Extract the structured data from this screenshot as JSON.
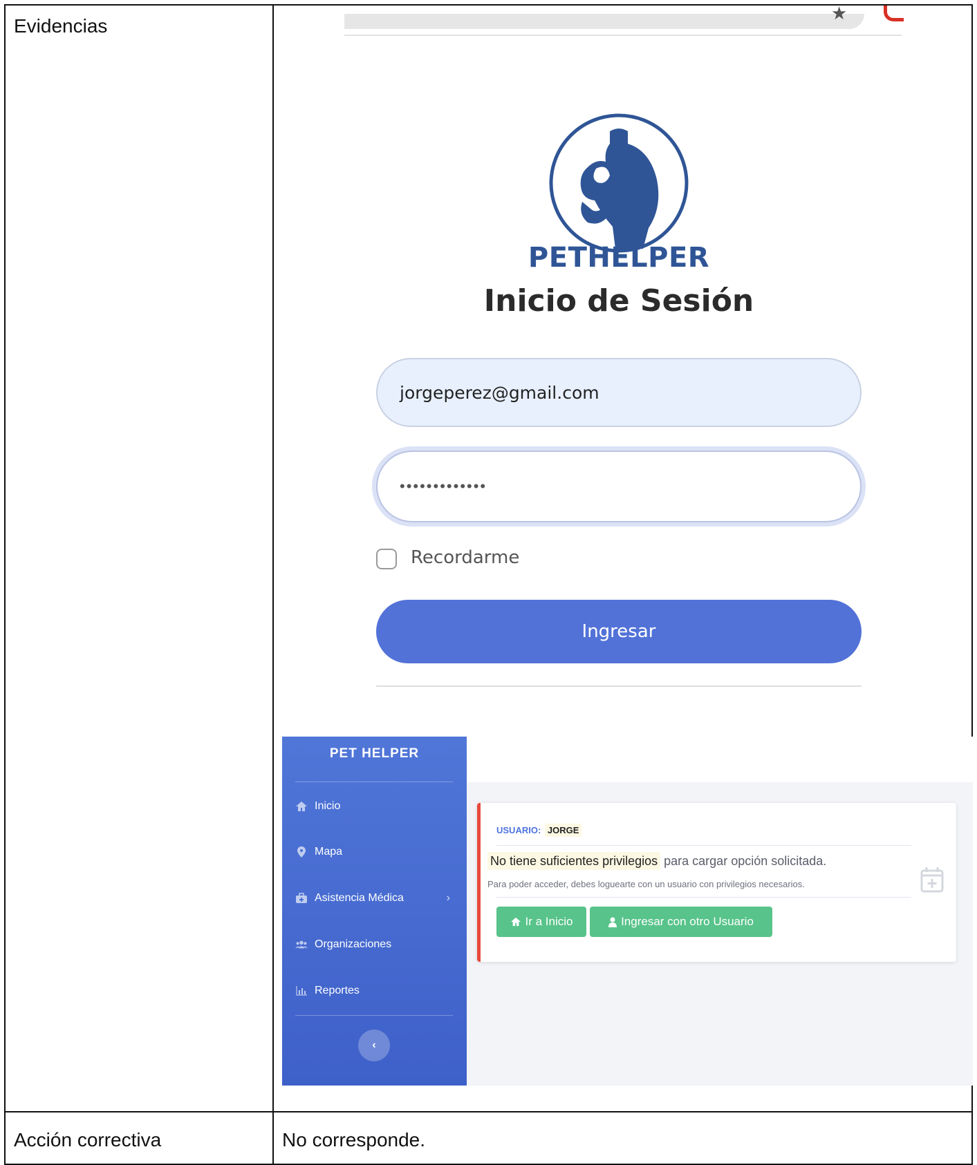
{
  "table": {
    "evidence_label": "Evidencias",
    "corrective_label": "Acción correctiva",
    "corrective_value": "No corresponde."
  },
  "login": {
    "brand": "PETHELPER",
    "title": "Inicio de Sesión",
    "email_value": "jorgeperez@gmail.com",
    "password_mask": "•••••••••••••",
    "remember_label": "Recordarme",
    "submit_label": "Ingresar"
  },
  "app": {
    "sidebar": {
      "brand": "PET HELPER",
      "items": [
        {
          "label": "Inicio",
          "icon": "home-icon"
        },
        {
          "label": "Mapa",
          "icon": "map-marker-icon"
        },
        {
          "label": "Asistencia Médica",
          "icon": "medkit-icon"
        },
        {
          "label": "Organizaciones",
          "icon": "users-icon"
        },
        {
          "label": "Reportes",
          "icon": "chart-icon"
        }
      ]
    },
    "alert": {
      "user_label": "USUARIO:",
      "user_name": "JORGE",
      "highlight": "No tiene suficientes privilegios",
      "message_rest": "para cargar opción solicitada.",
      "sub_message": "Para poder acceder, debes loguearte con un usuario con privilegios necesarios.",
      "home_button": "Ir a Inicio",
      "other_user_button": "Ingresar con otro Usuario"
    }
  },
  "colors": {
    "primary": "#5272d8",
    "sidebar_top": "#5076d8",
    "success": "#58c38a",
    "danger": "#e74a3b",
    "brand_text": "#2f5596"
  }
}
